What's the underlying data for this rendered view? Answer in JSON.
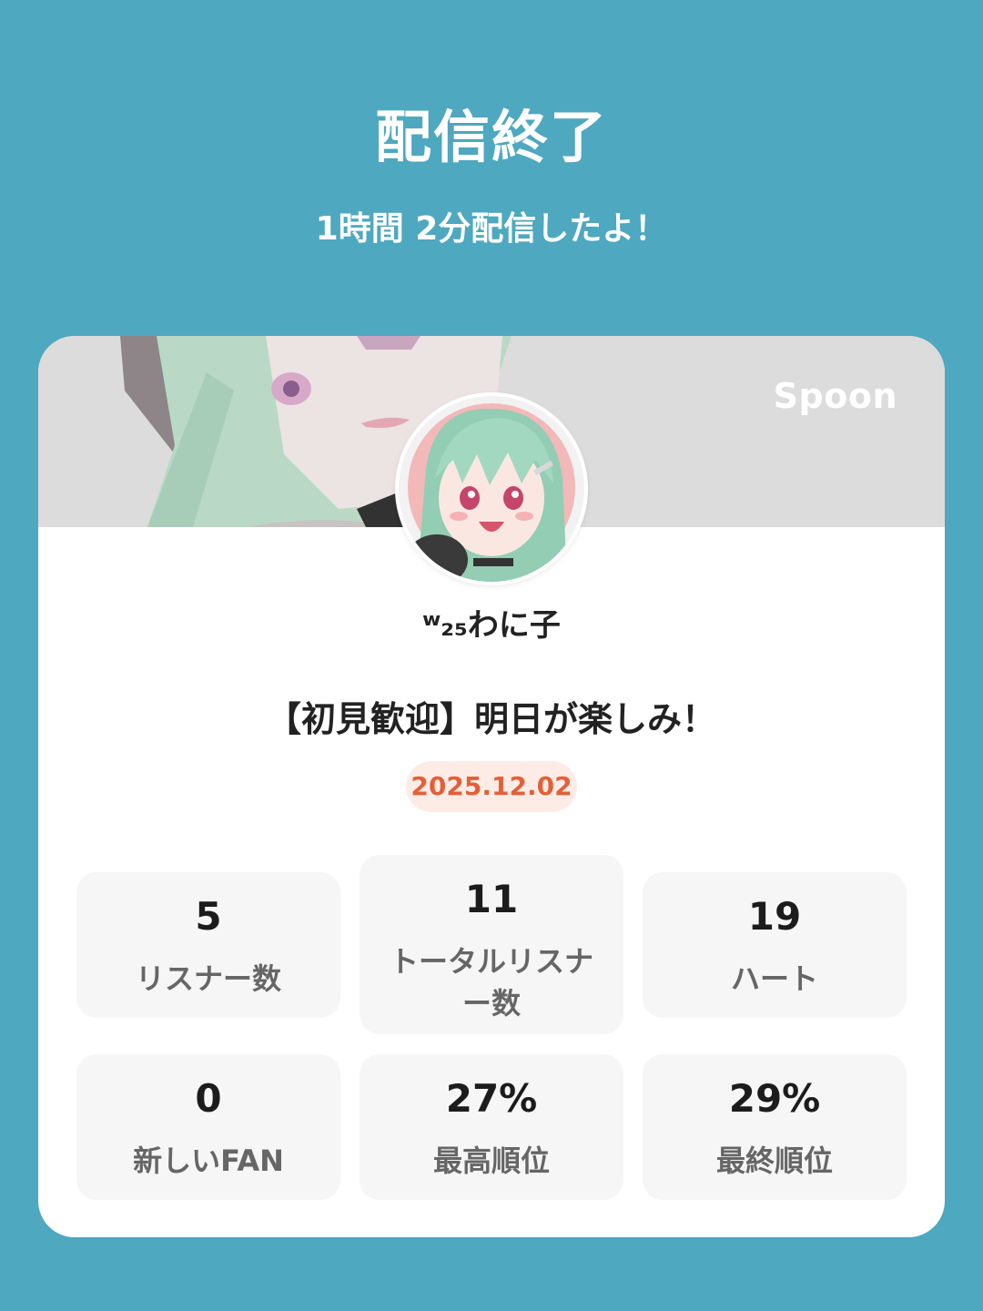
{
  "header": {
    "title": "配信終了",
    "subtitle": "1時間 2分配信したよ！"
  },
  "card": {
    "brand": "Spoon",
    "username": "ʷ₂₅わに子",
    "stream_title": "【初見歓迎】明日が楽しみ！",
    "date": "2025.12.02"
  },
  "stats": [
    {
      "value": "5",
      "label": "リスナー数"
    },
    {
      "value": "11",
      "label": "トータルリスナー数"
    },
    {
      "value": "19",
      "label": "ハート"
    },
    {
      "value": "0",
      "label": "新しいFAN"
    },
    {
      "value": "27%",
      "label": "最高順位"
    },
    {
      "value": "29%",
      "label": "最終順位"
    }
  ],
  "colors": {
    "background": "#4ea8bf",
    "card": "#ffffff",
    "stat_box": "#f6f6f6",
    "date_badge_bg": "#fdece6",
    "date_badge_text": "#e2603a"
  }
}
